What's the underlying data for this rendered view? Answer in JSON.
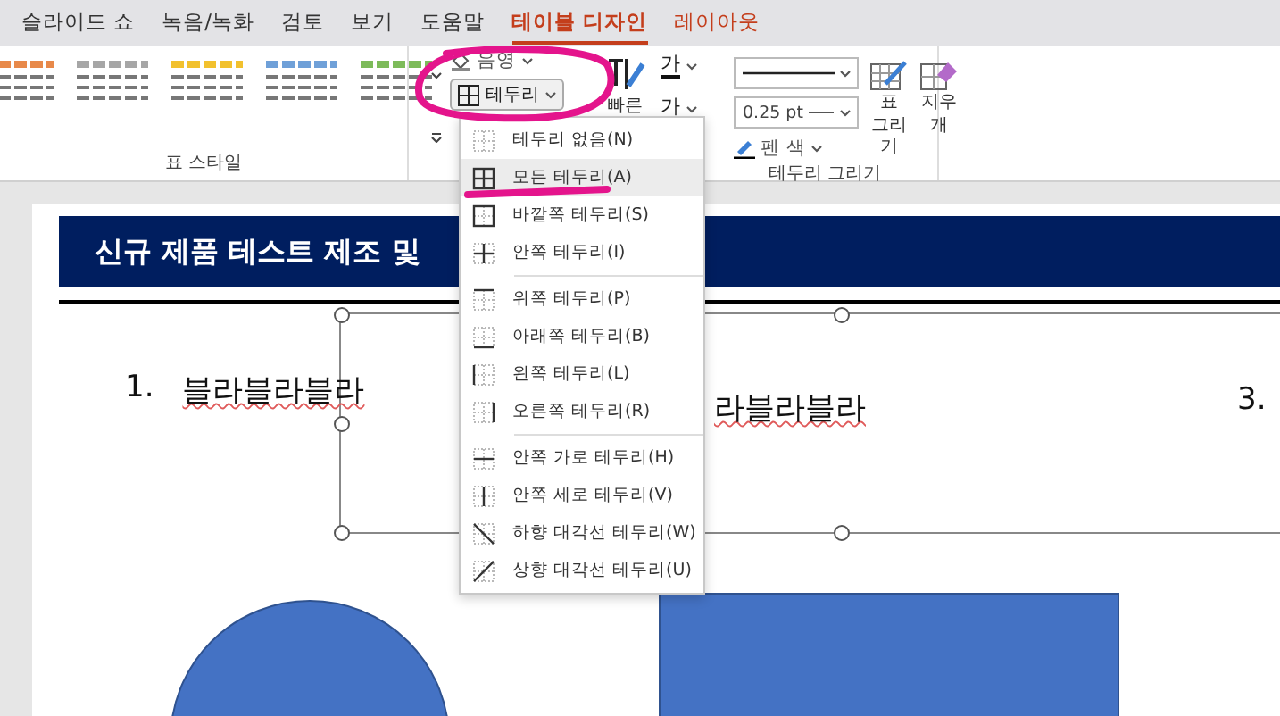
{
  "ribbon_tabs": [
    {
      "label": "슬라이드 쇼",
      "selected": false,
      "contextual": false
    },
    {
      "label": "녹음/녹화",
      "selected": false,
      "contextual": false
    },
    {
      "label": "검토",
      "selected": false,
      "contextual": false
    },
    {
      "label": "보기",
      "selected": false,
      "contextual": false
    },
    {
      "label": "도움말",
      "selected": false,
      "contextual": false
    },
    {
      "label": "테이블 디자인",
      "selected": true,
      "contextual": true
    },
    {
      "label": "레이아웃",
      "selected": false,
      "contextual": true
    }
  ],
  "table_styles": {
    "group_label": "표 스타일",
    "swatches": [
      {
        "color": "#e8894a"
      },
      {
        "color": "#a6a6a6"
      },
      {
        "color": "#f2c12e"
      },
      {
        "color": "#6fa0d8"
      },
      {
        "color": "#7dbb5a"
      }
    ]
  },
  "shading": {
    "label": "음영"
  },
  "borders_button": {
    "label": "테두리"
  },
  "quick_styles": {
    "label": "빠른"
  },
  "text_fill": {
    "label": "가"
  },
  "text_outline": {
    "label": "가"
  },
  "draw_borders": {
    "group_label": "테두리 그리기",
    "pen_weight": "0.25 pt",
    "pen_color": "펜 색",
    "draw_table": [
      "표",
      "그리기"
    ],
    "eraser": "지우개"
  },
  "borders_menu": {
    "groups": [
      [
        {
          "label": "테두리 없음(N)",
          "kind": "none",
          "selected": false
        },
        {
          "label": "모든 테두리(A)",
          "kind": "all",
          "selected": true
        },
        {
          "label": "바깥쪽 테두리(S)",
          "kind": "outside",
          "selected": false
        },
        {
          "label": "안쪽 테두리(I)",
          "kind": "inside",
          "selected": false
        }
      ],
      [
        {
          "label": "위쪽 테두리(P)",
          "kind": "top",
          "selected": false
        },
        {
          "label": "아래쪽 테두리(B)",
          "kind": "bottom",
          "selected": false
        },
        {
          "label": "왼쪽 테두리(L)",
          "kind": "left",
          "selected": false
        },
        {
          "label": "오른쪽 테두리(R)",
          "kind": "right",
          "selected": false
        }
      ],
      [
        {
          "label": "안쪽 가로 테두리(H)",
          "kind": "inside_h",
          "selected": false
        },
        {
          "label": "안쪽 세로 테두리(V)",
          "kind": "inside_v",
          "selected": false
        },
        {
          "label": "하향 대각선 테두리(W)",
          "kind": "diag_down",
          "selected": false
        },
        {
          "label": "상향 대각선 테두리(U)",
          "kind": "diag_up",
          "selected": false
        }
      ]
    ]
  },
  "slide": {
    "title": "신규 제품 테스트 제조 및",
    "items": [
      {
        "number": "1.",
        "text": "블라블라블라"
      },
      {
        "text": "라블라블라"
      },
      {
        "number": "3."
      }
    ]
  }
}
